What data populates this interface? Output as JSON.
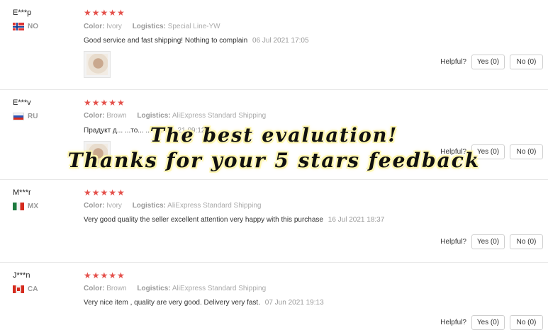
{
  "reviews": [
    {
      "name": "E***p",
      "country": "NO",
      "stars": "★★★★★",
      "color_label": "Color:",
      "color": "Ivory",
      "logistics_label": "Logistics:",
      "logistics": "Special Line-YW",
      "comment": "Good service and fast shipping! Nothing to complain",
      "date": "06 Jul 2021 17:05",
      "has_photo": true,
      "helpful_label": "Helpful?",
      "yes_label": "Yes (0)",
      "no_label": "No (0)"
    },
    {
      "name": "E***v",
      "country": "RU",
      "stars": "★★★★★",
      "color_label": "Color:",
      "color": "Brown",
      "logistics_label": "Logistics:",
      "logistics": "AliExpress Standard Shipping",
      "comment": "Прадукт д... ...то... ...",
      "date": "10 J... 21 09:12",
      "has_photo": true,
      "helpful_label": "Helpful?",
      "yes_label": "Yes (0)",
      "no_label": "No (0)"
    },
    {
      "name": "M***r",
      "country": "MX",
      "stars": "★★★★★",
      "color_label": "Color:",
      "color": "Ivory",
      "logistics_label": "Logistics:",
      "logistics": "AliExpress Standard Shipping",
      "comment": "Very good quality the seller excellent attention very happy with this purchase",
      "date": "16 Jul 2021 18:37",
      "has_photo": false,
      "helpful_label": "Helpful?",
      "yes_label": "Yes (0)",
      "no_label": "No (0)"
    },
    {
      "name": "J***n",
      "country": "CA",
      "stars": "★★★★★",
      "color_label": "Color:",
      "color": "Brown",
      "logistics_label": "Logistics:",
      "logistics": "AliExpress Standard Shipping",
      "comment": "Very nice item , quality are very good. Delivery very fast.",
      "date": "07 Jun 2021 19:13",
      "has_photo": false,
      "helpful_label": "Helpful?",
      "yes_label": "Yes (0)",
      "no_label": "No (0)"
    }
  ],
  "overlay": {
    "line1": "The best evaluation!",
    "line2": "Thanks for your 5 stars feedback"
  },
  "colors": {
    "star": "#e4504b",
    "overlay_glow": "#fff7b0"
  }
}
